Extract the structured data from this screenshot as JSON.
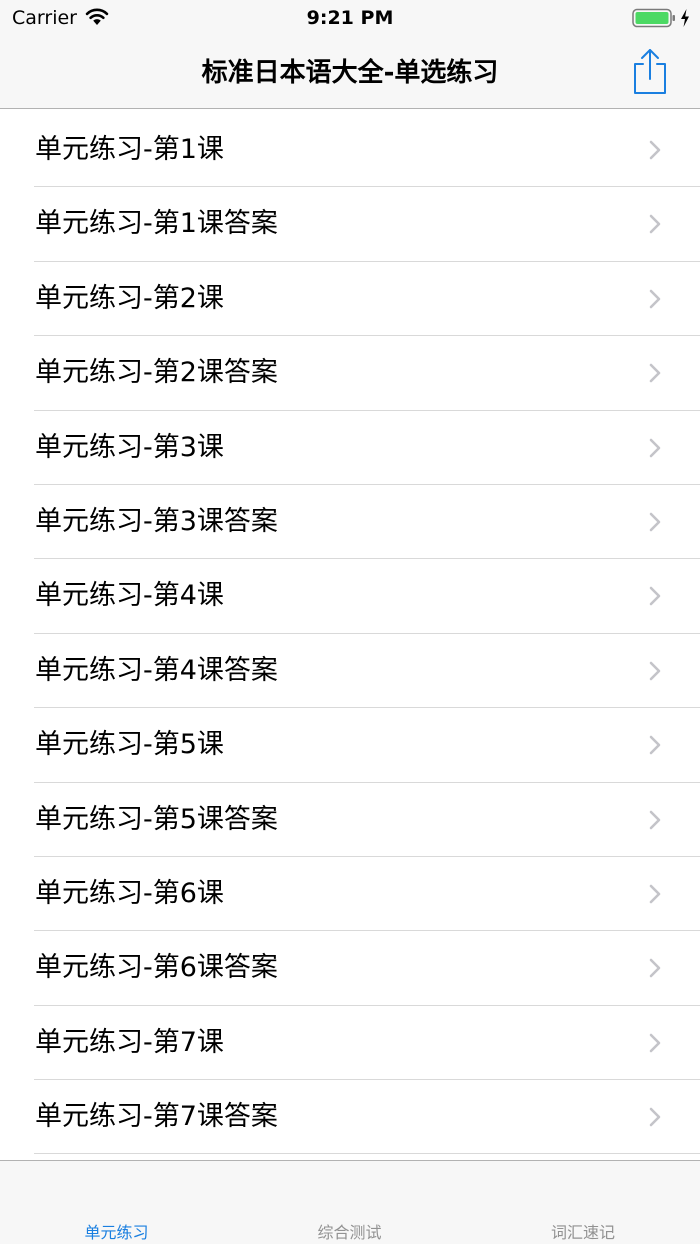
{
  "status_bar": {
    "carrier": "Carrier",
    "time": "9:21 PM",
    "battery_color": "#4cd964"
  },
  "nav_bar": {
    "title": "标准日本语大全-单选练习",
    "share_icon": "share-icon",
    "accent_color": "#1a7fe0"
  },
  "list": {
    "items": [
      {
        "label": "单元练习-第1课"
      },
      {
        "label": "单元练习-第1课答案"
      },
      {
        "label": "单元练习-第2课"
      },
      {
        "label": "单元练习-第2课答案"
      },
      {
        "label": "单元练习-第3课"
      },
      {
        "label": "单元练习-第3课答案"
      },
      {
        "label": "单元练习-第4课"
      },
      {
        "label": "单元练习-第4课答案"
      },
      {
        "label": "单元练习-第5课"
      },
      {
        "label": "单元练习-第5课答案"
      },
      {
        "label": "单元练习-第6课"
      },
      {
        "label": "单元练习-第6课答案"
      },
      {
        "label": "单元练习-第7课"
      },
      {
        "label": "单元练习-第7课答案"
      }
    ],
    "chevron_icon": "chevron-right-icon"
  },
  "tab_bar": {
    "tabs": [
      {
        "label": "单元练习",
        "active": true
      },
      {
        "label": "综合测试",
        "active": false
      },
      {
        "label": "词汇速记",
        "active": false
      }
    ],
    "active_color": "#1a7fe0",
    "inactive_color": "#929292"
  }
}
